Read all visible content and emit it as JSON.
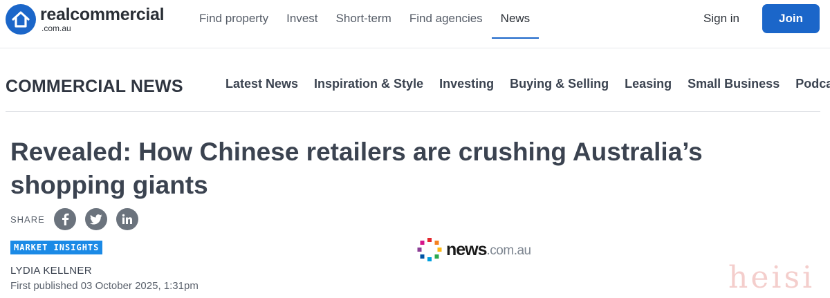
{
  "header": {
    "logo_main": "realcommercial",
    "logo_sub": ".com.au",
    "nav": [
      {
        "label": "Find property"
      },
      {
        "label": "Invest"
      },
      {
        "label": "Short-term"
      },
      {
        "label": "Find agencies"
      },
      {
        "label": "News",
        "active": true
      }
    ],
    "signin_label": "Sign in",
    "join_label": "Join"
  },
  "section": {
    "title": "COMMERCIAL NEWS",
    "nav": [
      {
        "label": "Latest News"
      },
      {
        "label": "Inspiration & Style"
      },
      {
        "label": "Investing"
      },
      {
        "label": "Buying & Selling"
      },
      {
        "label": "Leasing"
      },
      {
        "label": "Small Business"
      },
      {
        "label": "Podcast"
      }
    ]
  },
  "article": {
    "headline": "Revealed: How Chinese retailers are crushing Australia’s shopping giants",
    "share_label": "SHARE",
    "share_icons": [
      "facebook-icon",
      "twitter-icon",
      "linkedin-icon"
    ],
    "tag": "MARKET INSIGHTS",
    "author": "LYDIA KELLNER",
    "published": "First published 03 October 2025, 1:31pm",
    "source_main": "news",
    "source_sub": ".com.au"
  },
  "watermark": "heisi",
  "colors": {
    "brand_blue": "#1b66c9",
    "tag_blue": "#1b8ae6",
    "text_dark": "#3b4350",
    "social_grey": "#6b737d"
  }
}
